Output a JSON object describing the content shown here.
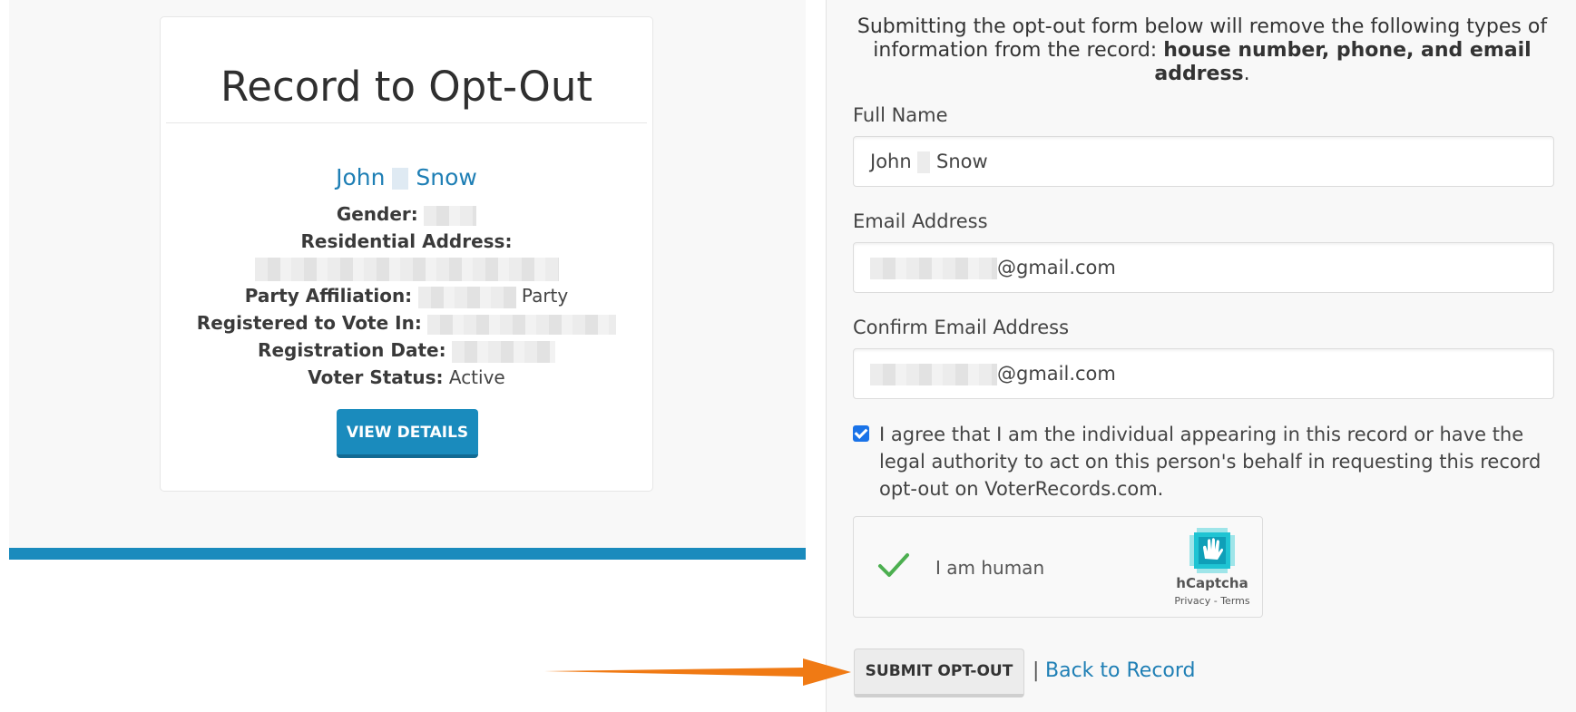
{
  "record_card": {
    "title": "Record to Opt-Out",
    "first_name": "John",
    "last_name": "Snow",
    "gender_label": "Gender:",
    "residential_address_label": "Residential Address:",
    "party_affiliation_label": "Party Affiliation:",
    "party_suffix": "Party",
    "registered_label": "Registered to Vote In:",
    "registration_date_label": "Registration Date:",
    "voter_status_label": "Voter Status:",
    "voter_status_value": "Active",
    "view_details_button": "VIEW DETAILS"
  },
  "form": {
    "intro_text": "Submitting the opt-out form below will remove the following types of information from the record: ",
    "intro_bold": "house number, phone, and email address",
    "intro_end": ".",
    "full_name_label": "Full Name",
    "full_name_first": "John",
    "full_name_last": "Snow",
    "email_label": "Email Address",
    "email_domain": "@gmail.com",
    "confirm_email_label": "Confirm Email Address",
    "confirm_email_domain": "@gmail.com",
    "agreement_checked": true,
    "agreement_text": "I agree that I am the individual appearing in this record or have the legal authority to act on this person's behalf in requesting this record opt-out on VoterRecords.com.",
    "captcha_label": "I am human",
    "captcha_brand": "hCaptcha",
    "captcha_links": "Privacy - Terms",
    "submit_button": "SUBMIT OPT-OUT",
    "separator": "|",
    "back_link": "Back to Record"
  },
  "colors": {
    "accent": "#1a8bbd",
    "link": "#1f7fb5",
    "annotation_arrow": "#f07a14",
    "captcha_check": "#4caf50"
  }
}
